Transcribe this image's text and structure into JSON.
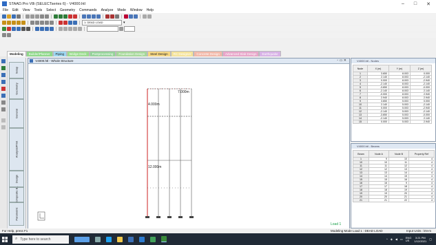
{
  "window": {
    "title": "STAAD.Pro V8i (SELECTseries 6) - V4000.htl"
  },
  "menu": [
    "File",
    "Edit",
    "View",
    "Tools",
    "Select",
    "Geometry",
    "Commands",
    "Analyze",
    "Mode",
    "Window",
    "Help"
  ],
  "toolbar": {
    "load_combo": "1: DEAD LOAD"
  },
  "tabs": [
    "Modeling",
    "Builder/Planner",
    "Piping",
    "Bridge Deck",
    "Postprocessing",
    "Foundation Design",
    "Steel Design",
    "RC Designer",
    "Concrete Design",
    "Advanced Slab Design",
    "Earthquake"
  ],
  "side_tabs": [
    "Setup",
    "Geometry",
    "General",
    "Analysis/Print",
    "Design",
    "Composite B..",
    "Parametric"
  ],
  "view": {
    "title": "V4000.htl - Whole Structure",
    "dim_top": "7.000m",
    "dim_mid": "4.000m",
    "dim_height": "12.000m",
    "load_label": "Load 1"
  },
  "nodes_table": {
    "title": "V4000.htl - Nodes",
    "headers": [
      "Node",
      "X (m)",
      "Y (m)",
      "Z (m)"
    ],
    "rows": [
      [
        "1",
        "3.650",
        "8.003",
        "0.000"
      ],
      [
        "2",
        "2.140",
        "8.003",
        "-2.140"
      ],
      [
        "3",
        "0.000",
        "8.003",
        "-2.940"
      ],
      [
        "4",
        "-2.140",
        "8.003",
        "-2.140"
      ],
      [
        "5",
        "-3.650",
        "8.003",
        "-0.000"
      ],
      [
        "6",
        "-2.140",
        "8.003",
        "2.140"
      ],
      [
        "7",
        "-0.000",
        "8.003",
        "2.940"
      ],
      [
        "8",
        "2.940",
        "8.003",
        "2.940"
      ],
      [
        "9",
        "3.650",
        "5.003",
        "0.000"
      ],
      [
        "10",
        "2.140",
        "5.003",
        "-2.140"
      ],
      [
        "11",
        "0.000",
        "5.003",
        "-2.940"
      ],
      [
        "12",
        "-2.140",
        "5.003",
        "-2.140"
      ],
      [
        "13",
        "-3.650",
        "5.003",
        "-0.000"
      ],
      [
        "14",
        "-2.140",
        "5.003",
        "2.140"
      ],
      [
        "15",
        "0.000",
        "5.003",
        "2.940"
      ]
    ]
  },
  "beams_table": {
    "title": "V4000.htl - Beams",
    "headers": [
      "Beam",
      "Node A",
      "Node B",
      "Property Ref"
    ],
    "rows": [
      [
        "1",
        "9",
        "10",
        "4"
      ],
      [
        "10",
        "10",
        "11",
        "4"
      ],
      [
        "11",
        "11",
        "12",
        "4"
      ],
      [
        "12",
        "12",
        "13",
        "4"
      ],
      [
        "13",
        "13",
        "14",
        "4"
      ],
      [
        "14",
        "14",
        "15",
        "4"
      ],
      [
        "15",
        "15",
        "16",
        "4"
      ],
      [
        "16",
        "16",
        "9",
        "4"
      ],
      [
        "17",
        "17",
        "18",
        "4"
      ],
      [
        "18",
        "18",
        "19",
        "4"
      ],
      [
        "19",
        "19",
        "20",
        "4"
      ],
      [
        "20",
        "20",
        "21",
        "4"
      ],
      [
        "21",
        "21",
        "22",
        "4"
      ]
    ]
  },
  "status": {
    "help": "For Help, press F1",
    "mode": "Modeling Mode  Load 1 : DEAD LOAD",
    "units": "Input Units : kN-m"
  },
  "taskbar": {
    "search_placeholder": "Type here to search",
    "time": "3:21 PM",
    "date": "1/12/2021",
    "lang": "ENG\nUS"
  },
  "colors": {
    "taskbar": "#202a36",
    "accent": "#2e6bc4",
    "member_red": "#cc2222"
  }
}
